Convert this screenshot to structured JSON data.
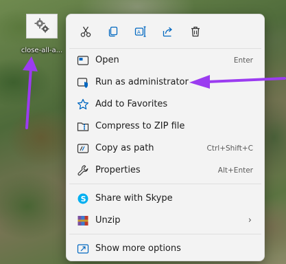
{
  "desktop": {
    "file_caption": "close-all-a..."
  },
  "toolbar": {
    "buttons": [
      {
        "name": "cut-icon"
      },
      {
        "name": "copy-icon"
      },
      {
        "name": "rename-icon"
      },
      {
        "name": "share-icon"
      },
      {
        "name": "delete-icon"
      }
    ]
  },
  "menu": {
    "items": [
      {
        "label": "Open",
        "shortcut": "Enter",
        "icon": "open-window-icon"
      },
      {
        "label": "Run as administrator",
        "shortcut": "",
        "icon": "shield-icon"
      },
      {
        "label": "Add to Favorites",
        "shortcut": "",
        "icon": "star-icon"
      },
      {
        "label": "Compress to ZIP file",
        "shortcut": "",
        "icon": "zip-folder-icon"
      },
      {
        "label": "Copy as path",
        "shortcut": "Ctrl+Shift+C",
        "icon": "copy-path-icon"
      },
      {
        "label": "Properties",
        "shortcut": "Alt+Enter",
        "icon": "wrench-icon"
      },
      {
        "label": "Share with Skype",
        "shortcut": "",
        "icon": "skype-icon"
      },
      {
        "label": "Unzip",
        "shortcut": "",
        "icon": "archive-icon",
        "submenu": true
      },
      {
        "label": "Show more options",
        "shortcut": "",
        "icon": "show-more-icon"
      }
    ]
  },
  "colors": {
    "accent": "#0067c0",
    "annotation_arrow": "#9b3cf0",
    "menu_bg": "#f3f3f3"
  }
}
